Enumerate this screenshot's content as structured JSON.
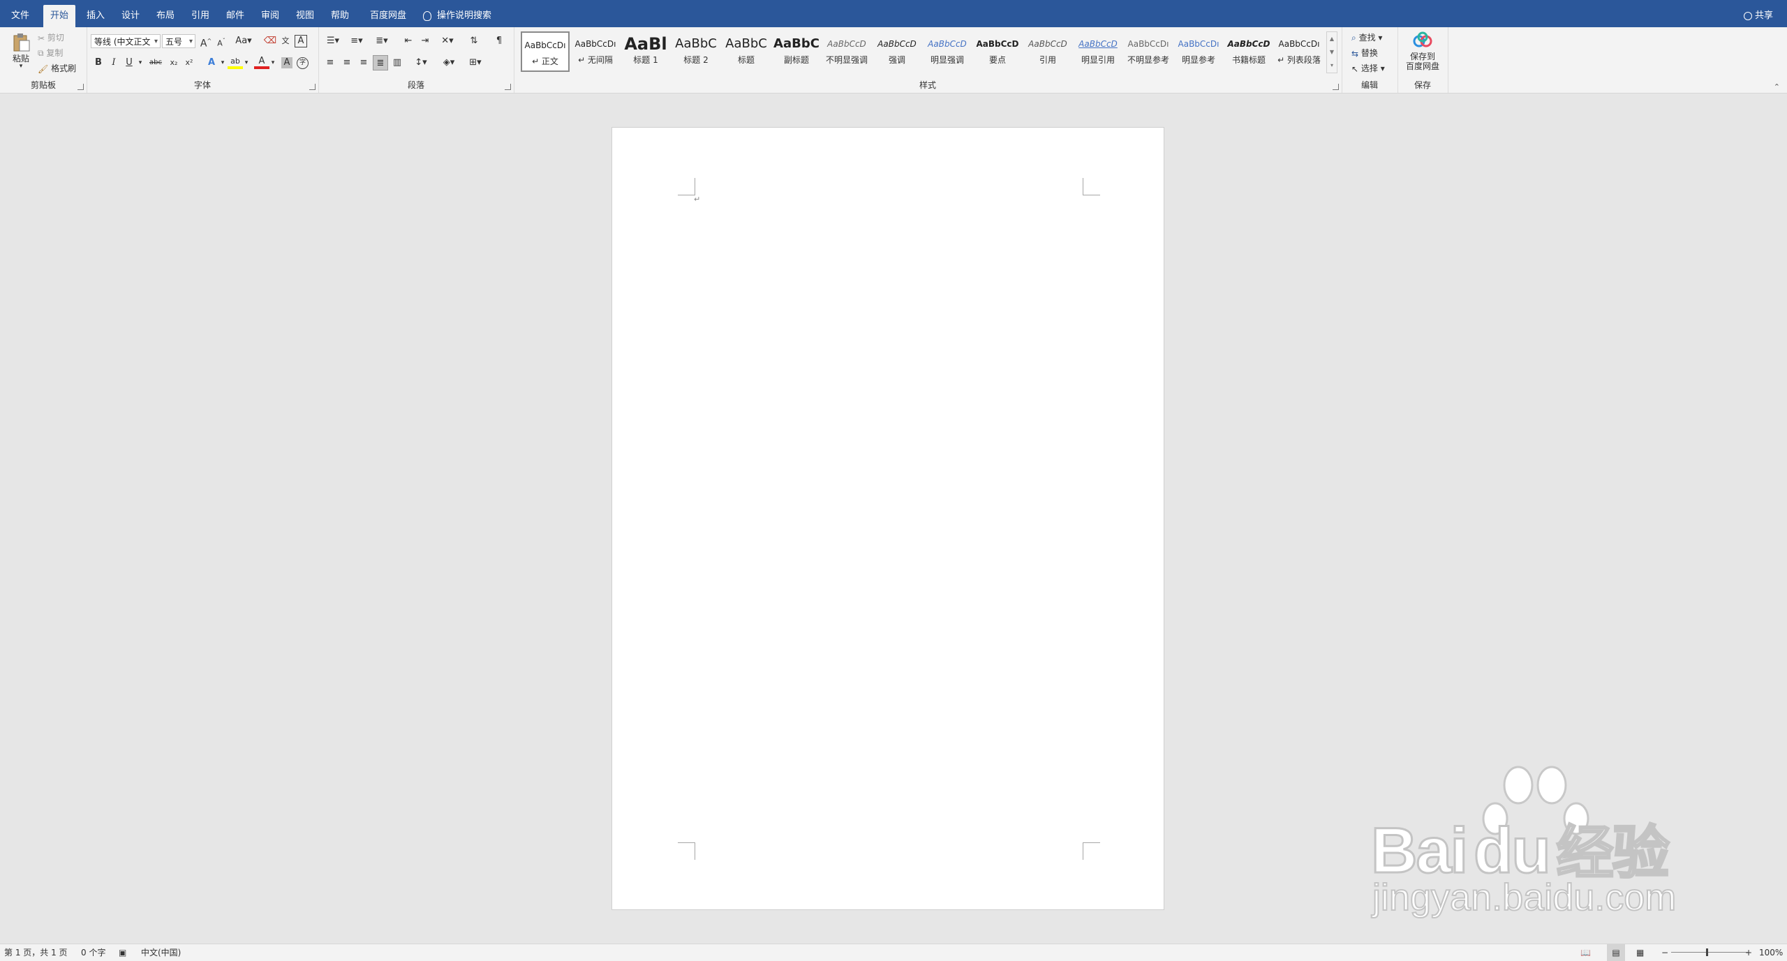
{
  "tabs": [
    "文件",
    "开始",
    "插入",
    "设计",
    "布局",
    "引用",
    "邮件",
    "审阅",
    "视图",
    "帮助",
    "百度网盘"
  ],
  "tell_me": "操作说明搜索",
  "share": "共享",
  "clipboard": {
    "paste": "粘贴",
    "cut": "剪切",
    "copy": "复制",
    "format_painter": "格式刷",
    "label": "剪贴板"
  },
  "font": {
    "name": "等线 (中文正文",
    "size": "五号",
    "label": "字体",
    "bold": "B",
    "italic": "I",
    "underline": "U",
    "strike": "abc",
    "sub": "x₂",
    "sup": "x²",
    "change_case": "Aa",
    "grow": "A",
    "shrink": "A",
    "text_effect": "A",
    "highlight": "ab",
    "font_color": "A",
    "char_shading": "A",
    "enclose": "字"
  },
  "paragraph": {
    "label": "段落"
  },
  "styles": {
    "label": "样式",
    "items": [
      {
        "preview": "AaBbCcDı",
        "name": "↵ 正文"
      },
      {
        "preview": "AaBbCcDı",
        "name": "↵ 无间隔"
      },
      {
        "preview": "AaBl",
        "name": "标题 1"
      },
      {
        "preview": "AaBbC",
        "name": "标题 2"
      },
      {
        "preview": "AaBbC",
        "name": "标题"
      },
      {
        "preview": "AaBbC",
        "name": "副标题"
      },
      {
        "preview": "AaBbCcD",
        "name": "不明显强调"
      },
      {
        "preview": "AaBbCcD",
        "name": "强调"
      },
      {
        "preview": "AaBbCcD",
        "name": "明显强调"
      },
      {
        "preview": "AaBbCcD",
        "name": "要点"
      },
      {
        "preview": "AaBbCcD",
        "name": "引用"
      },
      {
        "preview": "AaBbCcD",
        "name": "明显引用"
      },
      {
        "preview": "AaBbCcDı",
        "name": "不明显参考"
      },
      {
        "preview": "AaBbCcDı",
        "name": "明显参考"
      },
      {
        "preview": "AaBbCcD",
        "name": "书籍标题"
      },
      {
        "preview": "AaBbCcDı",
        "name": "↵ 列表段落"
      }
    ]
  },
  "editing": {
    "find": "查找",
    "replace": "替换",
    "select": "选择",
    "label": "编辑"
  },
  "save": {
    "line1": "保存到",
    "line2": "百度网盘",
    "label": "保存"
  },
  "document": {
    "paragraph_mark": "↵"
  },
  "status": {
    "page": "第 1 页，共 1 页",
    "words": "0 个字",
    "language": "中文(中国)",
    "zoom": "100%"
  },
  "watermark": {
    "brand": "Bai",
    "brand2": "du",
    "cn": "经验",
    "url": "jingyan.baidu.com"
  },
  "colors": {
    "titlebar": "#2b579a",
    "ribbon": "#f3f3f3",
    "canvas": "#e6e6e6"
  }
}
